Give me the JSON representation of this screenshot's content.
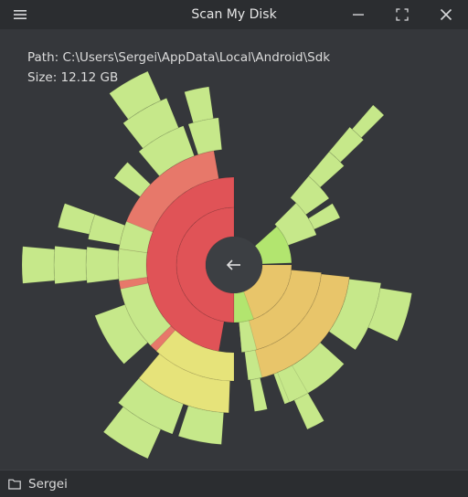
{
  "window": {
    "title": "Scan My Disk",
    "menu_icon": "hamburger-menu-icon",
    "minimize_icon": "minimize-icon",
    "maximize_icon": "maximize-icon",
    "close_icon": "close-icon"
  },
  "info": {
    "path_line": "Path: C:\\Users\\Sergei\\AppData\\Local\\Android\\Sdk",
    "size_line": "Size: 12.12 GB"
  },
  "center_button": {
    "icon": "back-arrow-icon"
  },
  "status_bar": {
    "icon": "folder-icon",
    "label": "Sergei"
  },
  "colors": {
    "background": "#35373b",
    "titlebar": "#2b2d30",
    "center_button": "#3c3f43",
    "red": "#e05357",
    "salmon": "#e7786a",
    "orange_yellow": "#e8c56a",
    "yellow": "#e6e37a",
    "light_green": "#c6e88a",
    "green": "#b2e56f"
  }
}
